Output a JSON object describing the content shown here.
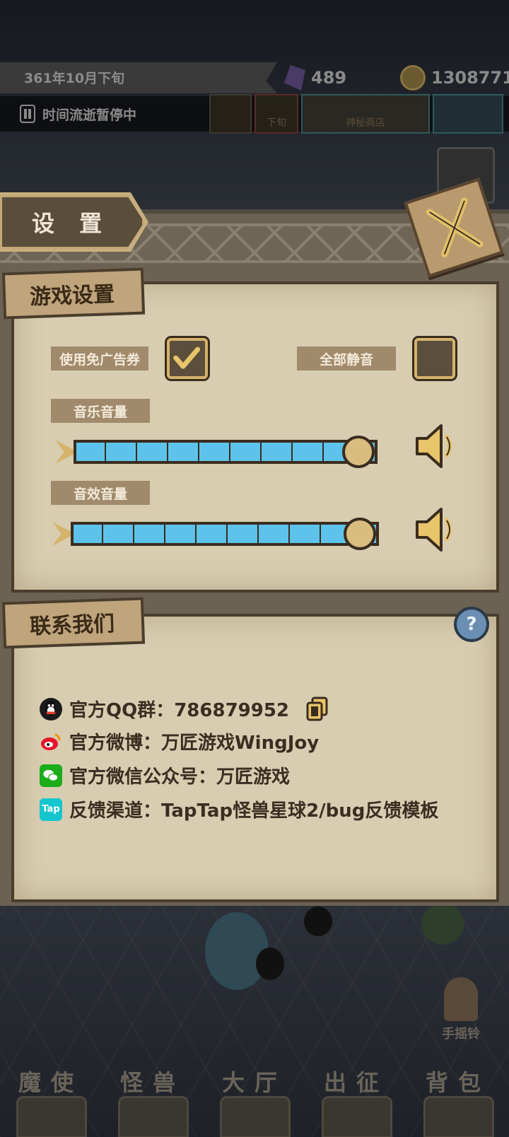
{
  "hud": {
    "date": "361年10月下旬",
    "crystal_count": "489",
    "coin_count": "1308771",
    "pause_status": "时间流逝暂停中",
    "shop_label": "神秘商店",
    "tab_small_1": "",
    "tab_small_2": "下旬"
  },
  "settings": {
    "title": "设 置",
    "game_section": {
      "title": "游戏设置",
      "ad_ticket_label": "使用免广告券",
      "ad_ticket_checked": true,
      "mute_all_label": "全部静音",
      "mute_all_checked": false,
      "music_volume_label": "音乐音量",
      "music_volume": 1.0,
      "sfx_volume_label": "音效音量",
      "sfx_volume": 1.0
    },
    "contact_section": {
      "title": "联系我们",
      "rows": [
        {
          "icon": "qq-icon",
          "text": "官方QQ群：786879952"
        },
        {
          "icon": "weibo-icon",
          "text": "官方微博：万匠游戏WingJoy"
        },
        {
          "icon": "wechat-icon",
          "text": "官方微信公众号：万匠游戏"
        },
        {
          "icon": "taptap-icon",
          "icon_text": "Tap",
          "text": "反馈渠道：TapTap怪兽星球2/bug反馈模板"
        }
      ]
    }
  },
  "bell": {
    "label": "手摇铃"
  },
  "bottom_nav": {
    "items": [
      "魔使",
      "怪兽",
      "大厅",
      "出征",
      "背包"
    ]
  },
  "colors": {
    "parchment": "#d8cdb1",
    "slider_fill": "#5ec3ea",
    "gold": "#d4b36a",
    "dark_brown": "#3a2c1e"
  }
}
